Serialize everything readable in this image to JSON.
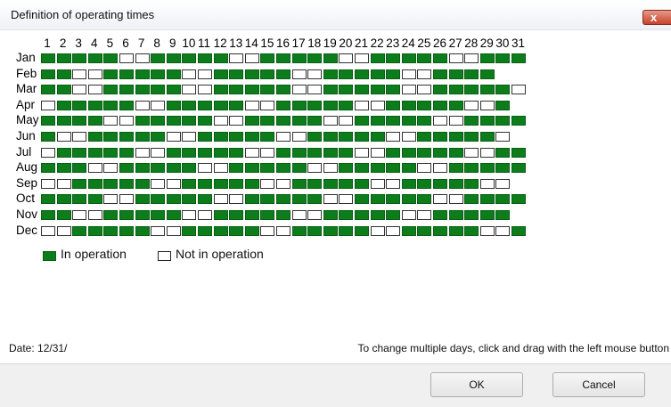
{
  "window": {
    "title": "Definition of operating times",
    "close_glyph": "x"
  },
  "calendar": {
    "days": [
      "1",
      "2",
      "3",
      "4",
      "5",
      "6",
      "7",
      "8",
      "9",
      "10",
      "11",
      "12",
      "13",
      "14",
      "15",
      "16",
      "17",
      "18",
      "19",
      "20",
      "21",
      "22",
      "23",
      "24",
      "25",
      "26",
      "27",
      "28",
      "29",
      "30",
      "31"
    ],
    "months": [
      {
        "label": "Jan",
        "pattern": "1111100111110011111001111100111"
      },
      {
        "label": "Feb",
        "pattern": "11001111100111110011111001111"
      },
      {
        "label": "Mar",
        "pattern": "1100111110011111001111100111110"
      },
      {
        "label": "Apr",
        "pattern": "011111001111100111110011111001"
      },
      {
        "label": "May",
        "pattern": "1111001111100111110011111001111"
      },
      {
        "label": "Jun",
        "pattern": "100111110011111001111100111110"
      },
      {
        "label": "Jul",
        "pattern": "0111110011111001111100111110011"
      },
      {
        "label": "Aug",
        "pattern": "1110011111001111100111110011111"
      },
      {
        "label": "Sep",
        "pattern": "001111100111110011111001111100"
      },
      {
        "label": "Oct",
        "pattern": "1111001111100111110011111001111"
      },
      {
        "label": "Nov",
        "pattern": "110011111001111100111110011111"
      },
      {
        "label": "Dec",
        "pattern": "0011111001111100111110011111001"
      }
    ]
  },
  "legend": {
    "on_label": "In operation",
    "off_label": "Not in operation"
  },
  "colors": {
    "on": "#0d7d1c",
    "off": "#ffffff"
  },
  "status": {
    "date": "Date:  12/31/",
    "hint": "To change multiple days, click and drag with the left mouse button"
  },
  "buttons": {
    "ok": "OK",
    "cancel": "Cancel"
  }
}
